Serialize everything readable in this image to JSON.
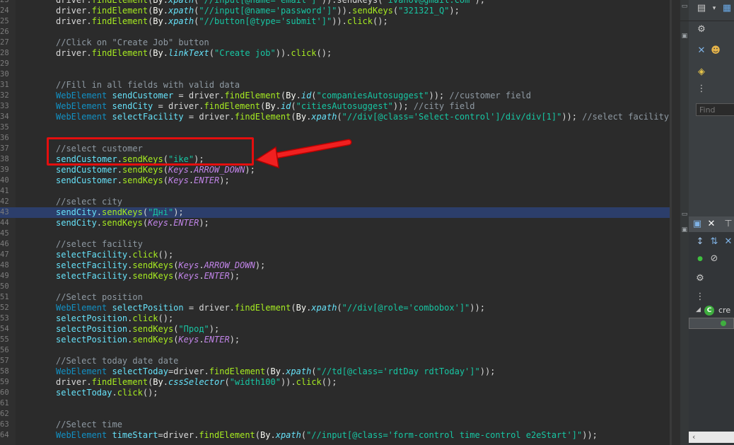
{
  "editor": {
    "lines": [
      {
        "n": "23",
        "tokens": [
          {
            "t": "driver.",
            "c": "k"
          },
          {
            "t": "findElement",
            "c": "m"
          },
          {
            "t": "(",
            "c": "k"
          },
          {
            "t": "By",
            "c": "ty"
          },
          {
            "t": ".",
            "c": "k"
          },
          {
            "t": "xpath",
            "c": "i"
          },
          {
            "t": "(",
            "c": "k"
          },
          {
            "t": "\"//input[@name='email']\"",
            "c": "s"
          },
          {
            "t": ")).sendKeys(",
            "c": "k"
          },
          {
            "t": "\"ivanov@gmail.com\"",
            "c": "s"
          },
          {
            "t": ");",
            "c": "k"
          }
        ]
      },
      {
        "n": "24",
        "tokens": [
          {
            "t": "driver.",
            "c": "k"
          },
          {
            "t": "findElement",
            "c": "m"
          },
          {
            "t": "(",
            "c": "k"
          },
          {
            "t": "By",
            "c": "ty"
          },
          {
            "t": ".",
            "c": "k"
          },
          {
            "t": "xpath",
            "c": "i"
          },
          {
            "t": "(",
            "c": "k"
          },
          {
            "t": "\"//input[@name='password']\"",
            "c": "s"
          },
          {
            "t": ")).",
            "c": "k"
          },
          {
            "t": "sendKeys",
            "c": "m"
          },
          {
            "t": "(",
            "c": "k"
          },
          {
            "t": "\"321321_Q\"",
            "c": "s"
          },
          {
            "t": ");",
            "c": "k"
          }
        ]
      },
      {
        "n": "25",
        "tokens": [
          {
            "t": "driver.",
            "c": "k"
          },
          {
            "t": "findElement",
            "c": "m"
          },
          {
            "t": "(",
            "c": "k"
          },
          {
            "t": "By",
            "c": "ty"
          },
          {
            "t": ".",
            "c": "k"
          },
          {
            "t": "xpath",
            "c": "i"
          },
          {
            "t": "(",
            "c": "k"
          },
          {
            "t": "\"//button[@type='submit']\"",
            "c": "s"
          },
          {
            "t": ")).",
            "c": "k"
          },
          {
            "t": "click",
            "c": "m"
          },
          {
            "t": "();",
            "c": "k"
          }
        ]
      },
      {
        "n": "26",
        "tokens": []
      },
      {
        "n": "27",
        "tokens": [
          {
            "t": "//Click on \"Create Job\" button",
            "c": "c"
          }
        ]
      },
      {
        "n": "28",
        "tokens": [
          {
            "t": "driver.",
            "c": "k"
          },
          {
            "t": "findElement",
            "c": "m"
          },
          {
            "t": "(",
            "c": "k"
          },
          {
            "t": "By",
            "c": "ty"
          },
          {
            "t": ".",
            "c": "k"
          },
          {
            "t": "linkText",
            "c": "i"
          },
          {
            "t": "(",
            "c": "k"
          },
          {
            "t": "\"Create job\"",
            "c": "s"
          },
          {
            "t": ")).",
            "c": "k"
          },
          {
            "t": "click",
            "c": "m"
          },
          {
            "t": "();",
            "c": "k"
          }
        ]
      },
      {
        "n": "29",
        "tokens": []
      },
      {
        "n": "30",
        "tokens": []
      },
      {
        "n": "31",
        "tokens": [
          {
            "t": "//Fill in all fields with valid data",
            "c": "c"
          }
        ]
      },
      {
        "n": "32",
        "tokens": [
          {
            "t": "WebElement ",
            "c": "tc"
          },
          {
            "t": "sendCustomer",
            "c": "f"
          },
          {
            "t": " = driver.",
            "c": "k"
          },
          {
            "t": "findElement",
            "c": "m"
          },
          {
            "t": "(",
            "c": "k"
          },
          {
            "t": "By",
            "c": "ty"
          },
          {
            "t": ".",
            "c": "k"
          },
          {
            "t": "id",
            "c": "i"
          },
          {
            "t": "(",
            "c": "k"
          },
          {
            "t": "\"companiesAutosuggest\"",
            "c": "s"
          },
          {
            "t": ")); ",
            "c": "k"
          },
          {
            "t": "//customer field",
            "c": "c"
          }
        ]
      },
      {
        "n": "33",
        "tokens": [
          {
            "t": "WebElement ",
            "c": "tc"
          },
          {
            "t": "sendCity",
            "c": "f"
          },
          {
            "t": " = driver.",
            "c": "k"
          },
          {
            "t": "findElement",
            "c": "m"
          },
          {
            "t": "(",
            "c": "k"
          },
          {
            "t": "By",
            "c": "ty"
          },
          {
            "t": ".",
            "c": "k"
          },
          {
            "t": "id",
            "c": "i"
          },
          {
            "t": "(",
            "c": "k"
          },
          {
            "t": "\"citiesAutosuggest\"",
            "c": "s"
          },
          {
            "t": ")); ",
            "c": "k"
          },
          {
            "t": "//city field",
            "c": "c"
          }
        ]
      },
      {
        "n": "34",
        "tokens": [
          {
            "t": "WebElement ",
            "c": "tc"
          },
          {
            "t": "selectFacility",
            "c": "f"
          },
          {
            "t": " = driver.",
            "c": "k"
          },
          {
            "t": "findElement",
            "c": "m"
          },
          {
            "t": "(",
            "c": "k"
          },
          {
            "t": "By",
            "c": "ty"
          },
          {
            "t": ".",
            "c": "k"
          },
          {
            "t": "xpath",
            "c": "i"
          },
          {
            "t": "(",
            "c": "k"
          },
          {
            "t": "\"//div[@class='Select-control']/div/div[1]\"",
            "c": "s"
          },
          {
            "t": ")); ",
            "c": "k"
          },
          {
            "t": "//select facility fro",
            "c": "c"
          }
        ]
      },
      {
        "n": "35",
        "tokens": []
      },
      {
        "n": "36",
        "tokens": []
      },
      {
        "n": "37",
        "tokens": [
          {
            "t": "//select customer",
            "c": "c"
          }
        ]
      },
      {
        "n": "38",
        "tokens": [
          {
            "t": "sendCustomer",
            "c": "f"
          },
          {
            "t": ".",
            "c": "k"
          },
          {
            "t": "sendKeys",
            "c": "m"
          },
          {
            "t": "(",
            "c": "k"
          },
          {
            "t": "\"ike\"",
            "c": "s"
          },
          {
            "t": ");",
            "c": "k"
          }
        ]
      },
      {
        "n": "39",
        "tokens": [
          {
            "t": "sendCustomer",
            "c": "f"
          },
          {
            "t": ".",
            "c": "k"
          },
          {
            "t": "sendKeys",
            "c": "m"
          },
          {
            "t": "(",
            "c": "k"
          },
          {
            "t": "Keys",
            "c": "e"
          },
          {
            "t": ".",
            "c": "k"
          },
          {
            "t": "ARROW_DOWN",
            "c": "e"
          },
          {
            "t": ");",
            "c": "k"
          }
        ]
      },
      {
        "n": "40",
        "tokens": [
          {
            "t": "sendCustomer",
            "c": "f"
          },
          {
            "t": ".",
            "c": "k"
          },
          {
            "t": "sendKeys",
            "c": "m"
          },
          {
            "t": "(",
            "c": "k"
          },
          {
            "t": "Keys",
            "c": "e"
          },
          {
            "t": ".",
            "c": "k"
          },
          {
            "t": "ENTER",
            "c": "e"
          },
          {
            "t": ");",
            "c": "k"
          }
        ]
      },
      {
        "n": "41",
        "tokens": []
      },
      {
        "n": "42",
        "tokens": [
          {
            "t": "//select city",
            "c": "c"
          }
        ]
      },
      {
        "n": "43",
        "highlight": true,
        "tokens": [
          {
            "t": "sendCity",
            "c": "f"
          },
          {
            "t": ".",
            "c": "k"
          },
          {
            "t": "sendKeys",
            "c": "m"
          },
          {
            "t": "(",
            "c": "k"
          },
          {
            "t": "\"Дні\"",
            "c": "s"
          },
          {
            "t": ");",
            "c": "k"
          }
        ]
      },
      {
        "n": "44",
        "tokens": [
          {
            "t": "sendCity",
            "c": "f"
          },
          {
            "t": ".",
            "c": "k"
          },
          {
            "t": "sendKeys",
            "c": "m"
          },
          {
            "t": "(",
            "c": "k"
          },
          {
            "t": "Keys",
            "c": "e"
          },
          {
            "t": ".",
            "c": "k"
          },
          {
            "t": "ENTER",
            "c": "e"
          },
          {
            "t": ");",
            "c": "k"
          }
        ]
      },
      {
        "n": "45",
        "tokens": []
      },
      {
        "n": "46",
        "tokens": [
          {
            "t": "//select facility",
            "c": "c"
          }
        ]
      },
      {
        "n": "47",
        "tokens": [
          {
            "t": "selectFacility",
            "c": "f"
          },
          {
            "t": ".",
            "c": "k"
          },
          {
            "t": "click",
            "c": "m"
          },
          {
            "t": "();",
            "c": "k"
          }
        ]
      },
      {
        "n": "48",
        "tokens": [
          {
            "t": "selectFacility",
            "c": "f"
          },
          {
            "t": ".",
            "c": "k"
          },
          {
            "t": "sendKeys",
            "c": "m"
          },
          {
            "t": "(",
            "c": "k"
          },
          {
            "t": "Keys",
            "c": "e"
          },
          {
            "t": ".",
            "c": "k"
          },
          {
            "t": "ARROW_DOWN",
            "c": "e"
          },
          {
            "t": ");",
            "c": "k"
          }
        ]
      },
      {
        "n": "49",
        "tokens": [
          {
            "t": "selectFacility",
            "c": "f"
          },
          {
            "t": ".",
            "c": "k"
          },
          {
            "t": "sendKeys",
            "c": "m"
          },
          {
            "t": "(",
            "c": "k"
          },
          {
            "t": "Keys",
            "c": "e"
          },
          {
            "t": ".",
            "c": "k"
          },
          {
            "t": "ENTER",
            "c": "e"
          },
          {
            "t": ");",
            "c": "k"
          }
        ]
      },
      {
        "n": "50",
        "tokens": []
      },
      {
        "n": "51",
        "tokens": [
          {
            "t": "//Select position",
            "c": "c"
          }
        ]
      },
      {
        "n": "52",
        "tokens": [
          {
            "t": "WebElement ",
            "c": "tc"
          },
          {
            "t": "selectPosition",
            "c": "f"
          },
          {
            "t": " = driver.",
            "c": "k"
          },
          {
            "t": "findElement",
            "c": "m"
          },
          {
            "t": "(",
            "c": "k"
          },
          {
            "t": "By",
            "c": "ty"
          },
          {
            "t": ".",
            "c": "k"
          },
          {
            "t": "xpath",
            "c": "i"
          },
          {
            "t": "(",
            "c": "k"
          },
          {
            "t": "\"//div[@role='combobox']\"",
            "c": "s"
          },
          {
            "t": "));",
            "c": "k"
          }
        ]
      },
      {
        "n": "53",
        "tokens": [
          {
            "t": "selectPosition",
            "c": "f"
          },
          {
            "t": ".",
            "c": "k"
          },
          {
            "t": "click",
            "c": "m"
          },
          {
            "t": "();",
            "c": "k"
          }
        ]
      },
      {
        "n": "54",
        "tokens": [
          {
            "t": "selectPosition",
            "c": "f"
          },
          {
            "t": ".",
            "c": "k"
          },
          {
            "t": "sendKeys",
            "c": "m"
          },
          {
            "t": "(",
            "c": "k"
          },
          {
            "t": "\"Прод\"",
            "c": "s"
          },
          {
            "t": ");",
            "c": "k"
          }
        ]
      },
      {
        "n": "55",
        "tokens": [
          {
            "t": "selectPosition",
            "c": "f"
          },
          {
            "t": ".",
            "c": "k"
          },
          {
            "t": "sendKeys",
            "c": "m"
          },
          {
            "t": "(",
            "c": "k"
          },
          {
            "t": "Keys",
            "c": "e"
          },
          {
            "t": ".",
            "c": "k"
          },
          {
            "t": "ENTER",
            "c": "e"
          },
          {
            "t": ");",
            "c": "k"
          }
        ]
      },
      {
        "n": "56",
        "tokens": []
      },
      {
        "n": "57",
        "tokens": [
          {
            "t": "//Select today date date",
            "c": "c"
          }
        ]
      },
      {
        "n": "58",
        "tokens": [
          {
            "t": "WebElement ",
            "c": "tc"
          },
          {
            "t": "selectToday",
            "c": "f"
          },
          {
            "t": "=driver.",
            "c": "k"
          },
          {
            "t": "findElement",
            "c": "m"
          },
          {
            "t": "(",
            "c": "k"
          },
          {
            "t": "By",
            "c": "ty"
          },
          {
            "t": ".",
            "c": "k"
          },
          {
            "t": "xpath",
            "c": "i"
          },
          {
            "t": "(",
            "c": "k"
          },
          {
            "t": "\"//td[@class='rdtDay rdtToday']\"",
            "c": "s"
          },
          {
            "t": "));",
            "c": "k"
          }
        ]
      },
      {
        "n": "59",
        "tokens": [
          {
            "t": "driver.",
            "c": "k"
          },
          {
            "t": "findElement",
            "c": "m"
          },
          {
            "t": "(",
            "c": "k"
          },
          {
            "t": "By",
            "c": "ty"
          },
          {
            "t": ".",
            "c": "k"
          },
          {
            "t": "cssSelector",
            "c": "i"
          },
          {
            "t": "(",
            "c": "k"
          },
          {
            "t": "\"width100\"",
            "c": "s"
          },
          {
            "t": ")).",
            "c": "k"
          },
          {
            "t": "click",
            "c": "m"
          },
          {
            "t": "();",
            "c": "k"
          }
        ]
      },
      {
        "n": "60",
        "tokens": [
          {
            "t": "selectToday",
            "c": "f"
          },
          {
            "t": ".",
            "c": "k"
          },
          {
            "t": "click",
            "c": "m"
          },
          {
            "t": "();",
            "c": "k"
          }
        ]
      },
      {
        "n": "61",
        "tokens": []
      },
      {
        "n": "62",
        "tokens": []
      },
      {
        "n": "63",
        "tokens": [
          {
            "t": "//Select time",
            "c": "c"
          }
        ]
      },
      {
        "n": "64",
        "tokens": [
          {
            "t": "WebElement ",
            "c": "tc"
          },
          {
            "t": "timeStart",
            "c": "f"
          },
          {
            "t": "=driver.",
            "c": "k"
          },
          {
            "t": "findElement",
            "c": "m"
          },
          {
            "t": "(",
            "c": "k"
          },
          {
            "t": "By",
            "c": "ty"
          },
          {
            "t": ".",
            "c": "k"
          },
          {
            "t": "xpath",
            "c": "i"
          },
          {
            "t": "(",
            "c": "k"
          },
          {
            "t": "\"//input[@class='form-control time-control e2eStart']\"",
            "c": "s"
          },
          {
            "t": "));",
            "c": "k"
          }
        ]
      }
    ]
  },
  "annotation": {
    "box_color": "#e40e0e",
    "arrow_color": "#e40e0e"
  },
  "right_panel": {
    "find_placeholder": "Find",
    "tree_item_label": "cre",
    "icons": [
      "new-file-icon",
      "dropdown-icon",
      "task-list-icon",
      "filter-icon",
      "people-icon",
      "focus-icon",
      "more-icon",
      "outline-icon",
      "close-icon",
      "hierarchy-icon",
      "sort-icon",
      "hide-fields-icon",
      "class-icon"
    ]
  },
  "colors": {
    "editor_bg": "#2b2b2b",
    "line_highlight": "#2c3e6b",
    "comment": "#8f9aa3",
    "string": "#17c6a3",
    "method": "#a7ec21"
  }
}
